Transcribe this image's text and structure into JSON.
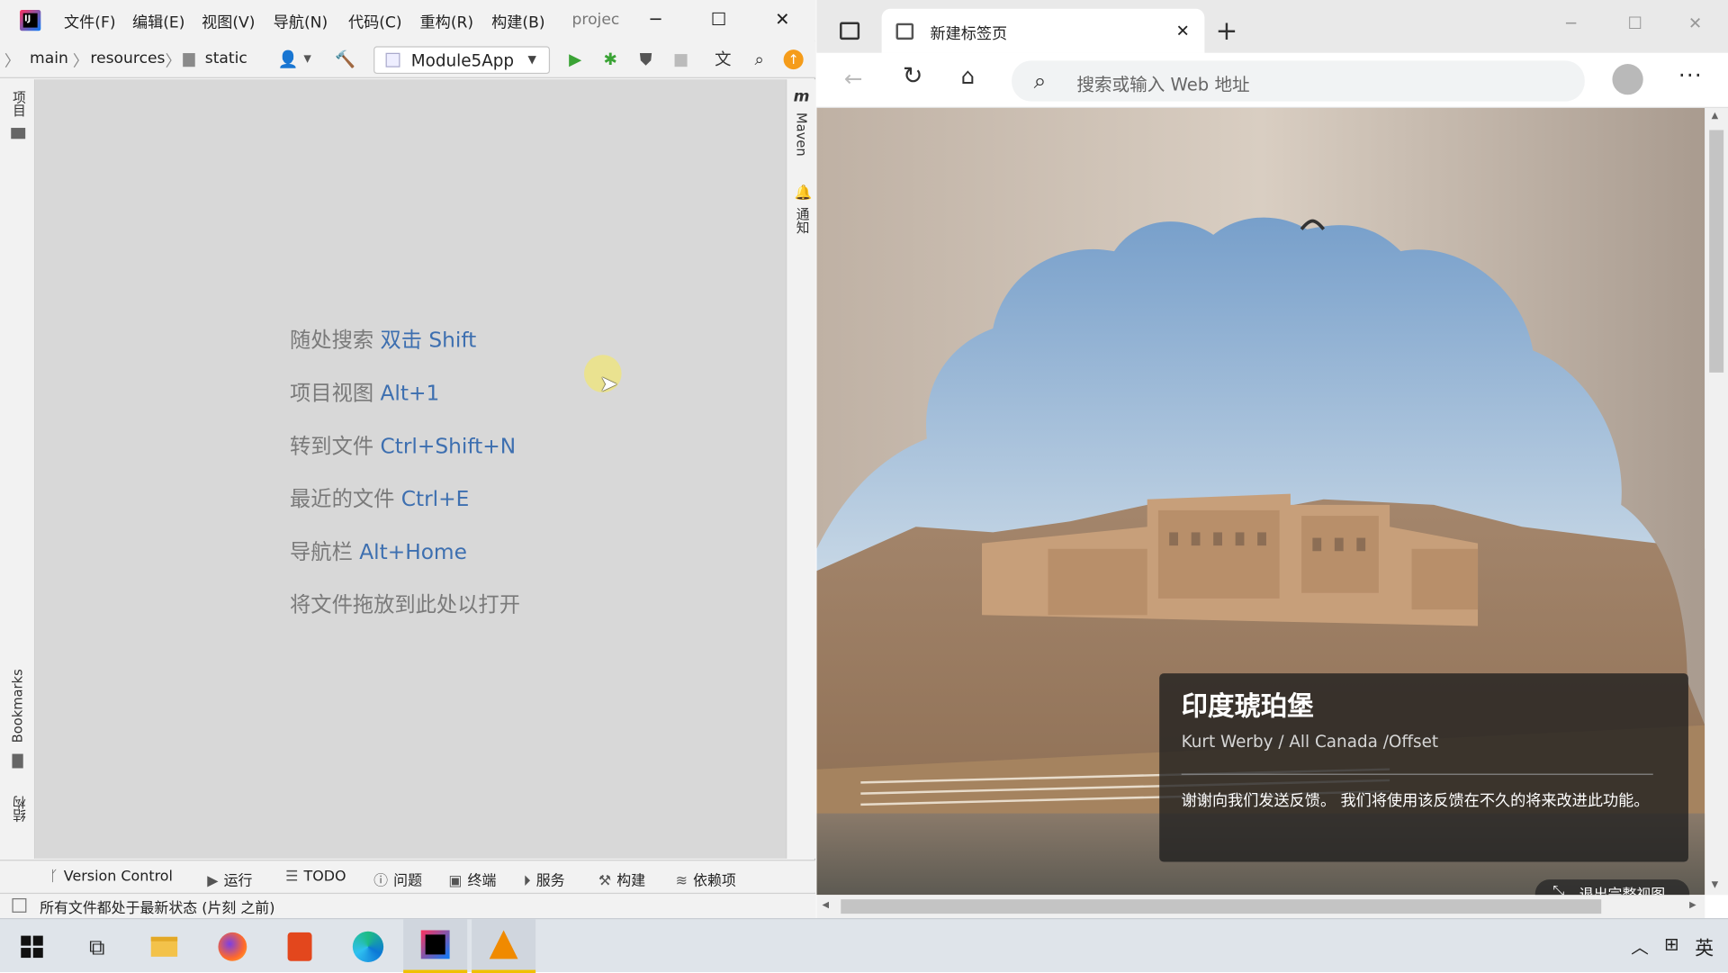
{
  "ide": {
    "menu": [
      "文件(F)",
      "编辑(E)",
      "视图(V)",
      "导航(N)",
      "代码(C)",
      "重构(R)",
      "构建(B)"
    ],
    "project_title": "projec",
    "breadcrumb": [
      "main",
      "resources",
      "static"
    ],
    "run_config": "Module5App",
    "left_tabs": {
      "project": "项目",
      "bookmarks": "Bookmarks",
      "structure": "结构"
    },
    "right_tabs": {
      "maven": "Maven",
      "notifications": "通知"
    },
    "hints": [
      {
        "label": "随处搜索",
        "key": "双击 Shift"
      },
      {
        "label": "项目视图",
        "key": "Alt+1"
      },
      {
        "label": "转到文件",
        "key": "Ctrl+Shift+N"
      },
      {
        "label": "最近的文件",
        "key": "Ctrl+E"
      },
      {
        "label": "导航栏",
        "key": "Alt+Home"
      },
      {
        "label": "将文件拖放到此处以打开",
        "key": ""
      }
    ],
    "tool_windows": [
      "Version Control",
      "运行",
      "TODO",
      "问题",
      "终端",
      "服务",
      "构建",
      "依赖项"
    ],
    "status_text": "所有文件都处于最新状态 (片刻 之前)"
  },
  "browser": {
    "tab_title": "新建标签页",
    "address_placeholder": "搜索或输入 Web 地址",
    "image_title": "印度琥珀堡",
    "image_credit": "Kurt Werby / All Canada /Offset",
    "feedback_text": "谢谢向我们发送反馈。 我们将使用该反馈在不久的将来改进此功能。",
    "exit_full_view": "退出完整视图"
  },
  "taskbar": {
    "apps": [
      "windows-start",
      "task-view",
      "file-explorer",
      "firefox",
      "office",
      "edge",
      "intellij",
      "vlc"
    ],
    "ime": "英"
  },
  "colors": {
    "accent_blue": "#3d6fb0",
    "editor_bg": "#d8d8d8",
    "run_green": "#3aa335",
    "update_orange": "#f59c1a"
  }
}
